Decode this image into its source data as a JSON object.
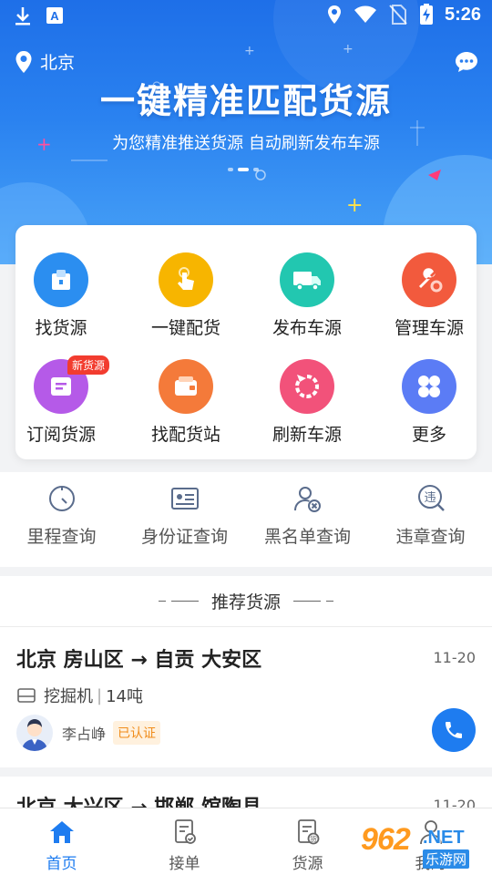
{
  "status_bar": {
    "time": "5:26"
  },
  "header": {
    "location": "北京",
    "headline": "一键精准匹配货源",
    "subline": "为您精准推送货源 自动刷新发布车源"
  },
  "grid": [
    {
      "label": "找货源",
      "color": "#2b8ef0",
      "icon": "cargo-box-icon"
    },
    {
      "label": "一键配货",
      "color": "#f7b500",
      "icon": "hand-tap-icon"
    },
    {
      "label": "发布车源",
      "color": "#22c7b0",
      "icon": "truck-icon"
    },
    {
      "label": "管理车源",
      "color": "#f25a3d",
      "icon": "wrench-gear-icon"
    },
    {
      "label": "订阅货源",
      "color": "#b55ae8",
      "icon": "subscribe-icon",
      "badge": "新货源"
    },
    {
      "label": "找配货站",
      "color": "#f47a3a",
      "icon": "wallet-icon"
    },
    {
      "label": "刷新车源",
      "color": "#f2527a",
      "icon": "refresh-icon"
    },
    {
      "label": "更多",
      "color": "#5b7cf5",
      "icon": "grid-more-icon"
    }
  ],
  "tools": [
    {
      "label": "里程查询",
      "icon": "mileage-icon"
    },
    {
      "label": "身份证查询",
      "icon": "id-card-icon"
    },
    {
      "label": "黑名单查询",
      "icon": "blacklist-icon"
    },
    {
      "label": "违章查询",
      "icon": "violation-icon"
    }
  ],
  "section": {
    "title": "推荐货源",
    "listing": {
      "route": "北京 房山区 → 自贡 大安区",
      "date": "11-20",
      "cargo": "挖掘机",
      "weight": "14吨",
      "person": "李占峥",
      "verified": "已认证"
    },
    "listing2": {
      "route": "北京 大兴区 → 邯郸 馆陶县",
      "date": "11-20"
    }
  },
  "bottom_nav": [
    {
      "label": "首页",
      "icon": "home-icon",
      "active": true
    },
    {
      "label": "接单",
      "icon": "order-icon",
      "active": false
    },
    {
      "label": "货源",
      "icon": "cargo-doc-icon",
      "active": false
    },
    {
      "label": "我的",
      "icon": "profile-icon",
      "active": false
    }
  ],
  "watermark": {
    "num": "962",
    "net": ".NET",
    "cn": "乐游网"
  }
}
